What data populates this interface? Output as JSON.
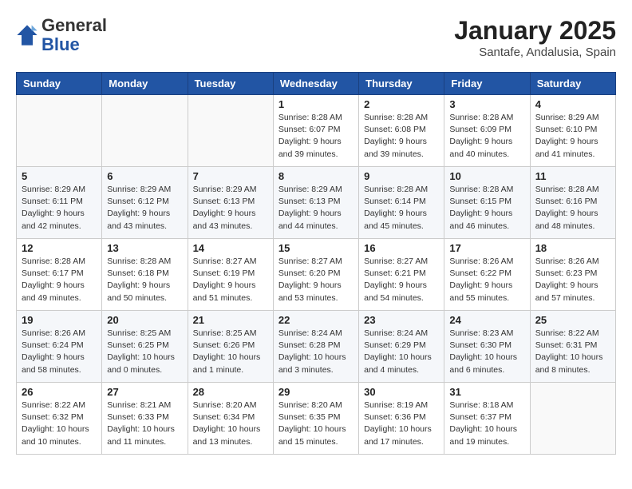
{
  "header": {
    "logo_general": "General",
    "logo_blue": "Blue",
    "month_year": "January 2025",
    "location": "Santafe, Andalusia, Spain"
  },
  "days_of_week": [
    "Sunday",
    "Monday",
    "Tuesday",
    "Wednesday",
    "Thursday",
    "Friday",
    "Saturday"
  ],
  "weeks": [
    [
      {
        "day": "",
        "sunrise": "",
        "sunset": "",
        "daylight": ""
      },
      {
        "day": "",
        "sunrise": "",
        "sunset": "",
        "daylight": ""
      },
      {
        "day": "",
        "sunrise": "",
        "sunset": "",
        "daylight": ""
      },
      {
        "day": "1",
        "sunrise": "Sunrise: 8:28 AM",
        "sunset": "Sunset: 6:07 PM",
        "daylight": "Daylight: 9 hours and 39 minutes."
      },
      {
        "day": "2",
        "sunrise": "Sunrise: 8:28 AM",
        "sunset": "Sunset: 6:08 PM",
        "daylight": "Daylight: 9 hours and 39 minutes."
      },
      {
        "day": "3",
        "sunrise": "Sunrise: 8:28 AM",
        "sunset": "Sunset: 6:09 PM",
        "daylight": "Daylight: 9 hours and 40 minutes."
      },
      {
        "day": "4",
        "sunrise": "Sunrise: 8:29 AM",
        "sunset": "Sunset: 6:10 PM",
        "daylight": "Daylight: 9 hours and 41 minutes."
      }
    ],
    [
      {
        "day": "5",
        "sunrise": "Sunrise: 8:29 AM",
        "sunset": "Sunset: 6:11 PM",
        "daylight": "Daylight: 9 hours and 42 minutes."
      },
      {
        "day": "6",
        "sunrise": "Sunrise: 8:29 AM",
        "sunset": "Sunset: 6:12 PM",
        "daylight": "Daylight: 9 hours and 43 minutes."
      },
      {
        "day": "7",
        "sunrise": "Sunrise: 8:29 AM",
        "sunset": "Sunset: 6:13 PM",
        "daylight": "Daylight: 9 hours and 43 minutes."
      },
      {
        "day": "8",
        "sunrise": "Sunrise: 8:29 AM",
        "sunset": "Sunset: 6:13 PM",
        "daylight": "Daylight: 9 hours and 44 minutes."
      },
      {
        "day": "9",
        "sunrise": "Sunrise: 8:28 AM",
        "sunset": "Sunset: 6:14 PM",
        "daylight": "Daylight: 9 hours and 45 minutes."
      },
      {
        "day": "10",
        "sunrise": "Sunrise: 8:28 AM",
        "sunset": "Sunset: 6:15 PM",
        "daylight": "Daylight: 9 hours and 46 minutes."
      },
      {
        "day": "11",
        "sunrise": "Sunrise: 8:28 AM",
        "sunset": "Sunset: 6:16 PM",
        "daylight": "Daylight: 9 hours and 48 minutes."
      }
    ],
    [
      {
        "day": "12",
        "sunrise": "Sunrise: 8:28 AM",
        "sunset": "Sunset: 6:17 PM",
        "daylight": "Daylight: 9 hours and 49 minutes."
      },
      {
        "day": "13",
        "sunrise": "Sunrise: 8:28 AM",
        "sunset": "Sunset: 6:18 PM",
        "daylight": "Daylight: 9 hours and 50 minutes."
      },
      {
        "day": "14",
        "sunrise": "Sunrise: 8:27 AM",
        "sunset": "Sunset: 6:19 PM",
        "daylight": "Daylight: 9 hours and 51 minutes."
      },
      {
        "day": "15",
        "sunrise": "Sunrise: 8:27 AM",
        "sunset": "Sunset: 6:20 PM",
        "daylight": "Daylight: 9 hours and 53 minutes."
      },
      {
        "day": "16",
        "sunrise": "Sunrise: 8:27 AM",
        "sunset": "Sunset: 6:21 PM",
        "daylight": "Daylight: 9 hours and 54 minutes."
      },
      {
        "day": "17",
        "sunrise": "Sunrise: 8:26 AM",
        "sunset": "Sunset: 6:22 PM",
        "daylight": "Daylight: 9 hours and 55 minutes."
      },
      {
        "day": "18",
        "sunrise": "Sunrise: 8:26 AM",
        "sunset": "Sunset: 6:23 PM",
        "daylight": "Daylight: 9 hours and 57 minutes."
      }
    ],
    [
      {
        "day": "19",
        "sunrise": "Sunrise: 8:26 AM",
        "sunset": "Sunset: 6:24 PM",
        "daylight": "Daylight: 9 hours and 58 minutes."
      },
      {
        "day": "20",
        "sunrise": "Sunrise: 8:25 AM",
        "sunset": "Sunset: 6:25 PM",
        "daylight": "Daylight: 10 hours and 0 minutes."
      },
      {
        "day": "21",
        "sunrise": "Sunrise: 8:25 AM",
        "sunset": "Sunset: 6:26 PM",
        "daylight": "Daylight: 10 hours and 1 minute."
      },
      {
        "day": "22",
        "sunrise": "Sunrise: 8:24 AM",
        "sunset": "Sunset: 6:28 PM",
        "daylight": "Daylight: 10 hours and 3 minutes."
      },
      {
        "day": "23",
        "sunrise": "Sunrise: 8:24 AM",
        "sunset": "Sunset: 6:29 PM",
        "daylight": "Daylight: 10 hours and 4 minutes."
      },
      {
        "day": "24",
        "sunrise": "Sunrise: 8:23 AM",
        "sunset": "Sunset: 6:30 PM",
        "daylight": "Daylight: 10 hours and 6 minutes."
      },
      {
        "day": "25",
        "sunrise": "Sunrise: 8:22 AM",
        "sunset": "Sunset: 6:31 PM",
        "daylight": "Daylight: 10 hours and 8 minutes."
      }
    ],
    [
      {
        "day": "26",
        "sunrise": "Sunrise: 8:22 AM",
        "sunset": "Sunset: 6:32 PM",
        "daylight": "Daylight: 10 hours and 10 minutes."
      },
      {
        "day": "27",
        "sunrise": "Sunrise: 8:21 AM",
        "sunset": "Sunset: 6:33 PM",
        "daylight": "Daylight: 10 hours and 11 minutes."
      },
      {
        "day": "28",
        "sunrise": "Sunrise: 8:20 AM",
        "sunset": "Sunset: 6:34 PM",
        "daylight": "Daylight: 10 hours and 13 minutes."
      },
      {
        "day": "29",
        "sunrise": "Sunrise: 8:20 AM",
        "sunset": "Sunset: 6:35 PM",
        "daylight": "Daylight: 10 hours and 15 minutes."
      },
      {
        "day": "30",
        "sunrise": "Sunrise: 8:19 AM",
        "sunset": "Sunset: 6:36 PM",
        "daylight": "Daylight: 10 hours and 17 minutes."
      },
      {
        "day": "31",
        "sunrise": "Sunrise: 8:18 AM",
        "sunset": "Sunset: 6:37 PM",
        "daylight": "Daylight: 10 hours and 19 minutes."
      },
      {
        "day": "",
        "sunrise": "",
        "sunset": "",
        "daylight": ""
      }
    ]
  ]
}
